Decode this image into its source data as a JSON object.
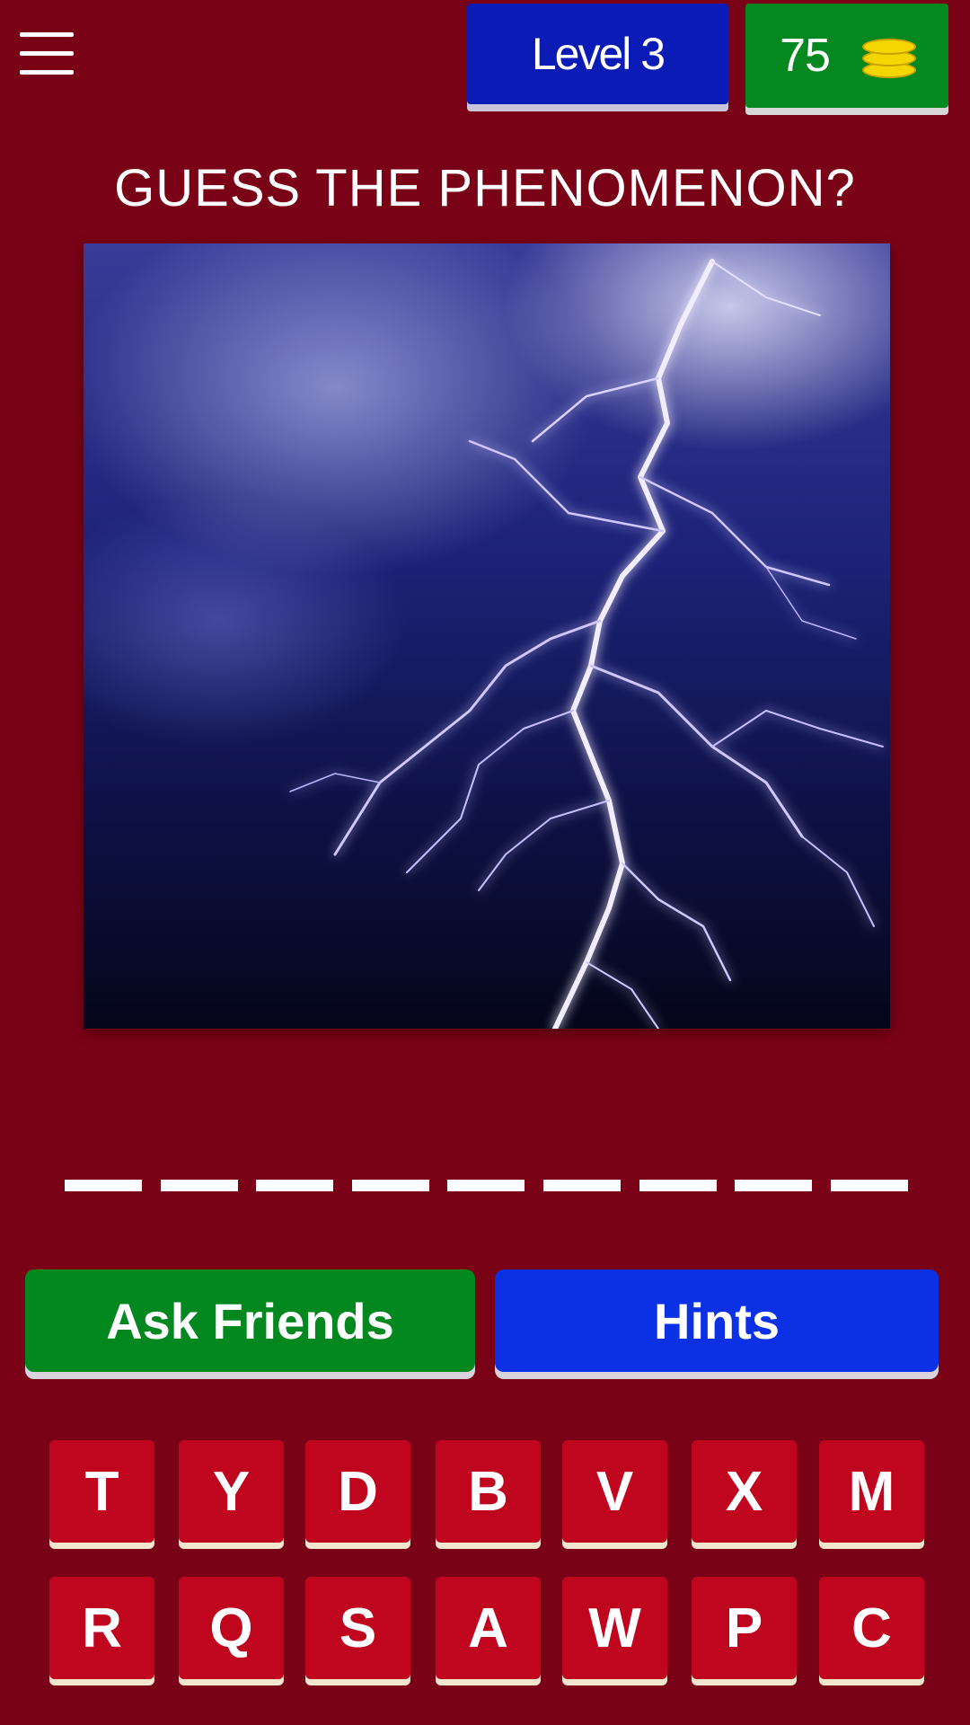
{
  "header": {
    "level_label": "Level 3",
    "coins": "75"
  },
  "question": "GUESS THE PHENOMENON?",
  "image": {
    "subject": "lightning"
  },
  "answer": {
    "slot_count": 9
  },
  "actions": {
    "ask_friends_label": "Ask Friends",
    "hints_label": "Hints"
  },
  "letters": {
    "row1": [
      "T",
      "Y",
      "D",
      "B",
      "V",
      "X",
      "M"
    ],
    "row2": [
      "R",
      "Q",
      "S",
      "A",
      "W",
      "P",
      "C"
    ]
  },
  "colors": {
    "background": "#7a0216",
    "level_badge": "#0a1cb5",
    "coins_badge": "#058820",
    "ask_friends": "#03871f",
    "hints": "#0c30e3",
    "letter_tile": "#c0061f",
    "coin": "#f6d600"
  }
}
